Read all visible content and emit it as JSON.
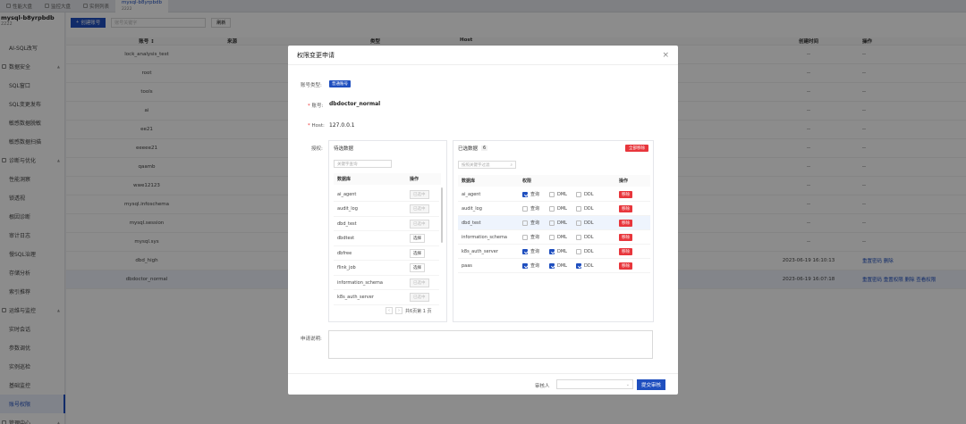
{
  "tabs": [
    {
      "label": "性能大盘"
    },
    {
      "label": "监控大盘"
    },
    {
      "label": "实例列表"
    },
    {
      "label": "mysql-b8yrpbdb",
      "sub": "2222"
    }
  ],
  "sidebar": {
    "title": "mysql-b8yrpbdb",
    "subtitle": "2222",
    "items": [
      {
        "label": "AI-SQL改写"
      },
      {
        "label": "数据安全",
        "group": true,
        "arrow": "▲"
      },
      {
        "label": "SQL窗口"
      },
      {
        "label": "SQL变更发布"
      },
      {
        "label": "敏感数据脱敏"
      },
      {
        "label": "敏感数据扫描"
      },
      {
        "label": "诊断与优化",
        "group": true,
        "arrow": "▲"
      },
      {
        "label": "性能洞察"
      },
      {
        "label": "锁透视"
      },
      {
        "label": "根因诊断"
      },
      {
        "label": "审计日志"
      },
      {
        "label": "慢SQL治理"
      },
      {
        "label": "存储分析"
      },
      {
        "label": "索引推荐"
      },
      {
        "label": "运维与监控",
        "group": true,
        "arrow": "▲"
      },
      {
        "label": "实时会话"
      },
      {
        "label": "参数调优"
      },
      {
        "label": "实例巡检"
      },
      {
        "label": "基础监控"
      },
      {
        "label": "账号权限",
        "active": true
      },
      {
        "label": "管理中心",
        "group": true,
        "arrow": "▲"
      }
    ]
  },
  "toolbar": {
    "create": "创建账号",
    "search_placeholder": "账号关键字",
    "refresh": "刷新"
  },
  "bg_table": {
    "headers": [
      "账号 ↕",
      "来源",
      "类型",
      "Host",
      "创建时间",
      "操作"
    ],
    "rows": [
      {
        "account": "lock_analysis_test",
        "time": "--",
        "op": "--"
      },
      {
        "account": "root",
        "time": "--",
        "op": "--"
      },
      {
        "account": "tools",
        "time": "--",
        "op": "--"
      },
      {
        "account": "ai",
        "time": "--",
        "op": "--"
      },
      {
        "account": "ee21",
        "time": "--",
        "op": "--"
      },
      {
        "account": "eeeee21",
        "time": "--",
        "op": "--"
      },
      {
        "account": "qaamb",
        "time": "--",
        "op": "--"
      },
      {
        "account": "wwe12123",
        "time": "--",
        "op": "--"
      },
      {
        "account": "mysql.infoschema",
        "time": "--",
        "op": "--"
      },
      {
        "account": "mysql.session",
        "time": "--",
        "op": "--"
      },
      {
        "account": "mysql.sys",
        "time": "--",
        "op": "--"
      },
      {
        "account": "dbd_high",
        "time": "2023-06-19 16:10:13",
        "op": "重置密码  删除"
      },
      {
        "account": "dbdoctor_normal",
        "time": "2023-06-19 16:07:18",
        "op": "重置密码  重置权限  删除  查看权限"
      }
    ]
  },
  "modal": {
    "title": "权限变更申请",
    "close": "×",
    "account_type_label": "账号类型:",
    "account_type_value": "普通账号",
    "account_label": "账号:",
    "account_value": "dbdoctor_normal",
    "host_label": "Host:",
    "host_value": "127.0.0.1",
    "grant_label": "授权:",
    "left": {
      "title": "待选数据",
      "search_placeholder": "关键字查询",
      "headers": [
        "数据库",
        "操作"
      ],
      "rows": [
        {
          "db": "ai_agent",
          "op": "已选中",
          "disabled": true
        },
        {
          "db": "audit_log",
          "op": "已选中",
          "disabled": true
        },
        {
          "db": "dbd_test",
          "op": "已选中",
          "disabled": true
        },
        {
          "db": "dbdtest",
          "op": "选择",
          "disabled": false
        },
        {
          "db": "dbfree",
          "op": "选择",
          "disabled": false
        },
        {
          "db": "flink_job",
          "op": "选择",
          "disabled": false
        },
        {
          "db": "information_schema",
          "op": "已选中",
          "disabled": true
        },
        {
          "db": "k8s_auth_server",
          "op": "已选中",
          "disabled": true
        }
      ],
      "pager": "共6页第 1 页",
      "prev": "‹",
      "next": "›"
    },
    "right": {
      "title": "已选数据",
      "count": "6",
      "remove_all": "全部移除",
      "search_placeholder": "按照关键字过滤",
      "headers": [
        "数据库",
        "权限",
        "操作"
      ],
      "perm_labels": [
        "查询",
        "DML",
        "DDL"
      ],
      "remove": "移除",
      "rows": [
        {
          "db": "ai_agent",
          "perms": [
            true,
            false,
            false
          ]
        },
        {
          "db": "audit_log",
          "perms": [
            false,
            false,
            false
          ]
        },
        {
          "db": "dbd_test",
          "perms": [
            false,
            false,
            false
          ]
        },
        {
          "db": "information_schema",
          "perms": [
            false,
            false,
            false
          ]
        },
        {
          "db": "k8s_auth_server",
          "perms": [
            true,
            true,
            false
          ]
        },
        {
          "db": "paas",
          "perms": [
            true,
            true,
            true
          ]
        }
      ]
    },
    "note_label": "申请说明:",
    "reviewer_label": "审核人",
    "submit": "提交审核"
  }
}
